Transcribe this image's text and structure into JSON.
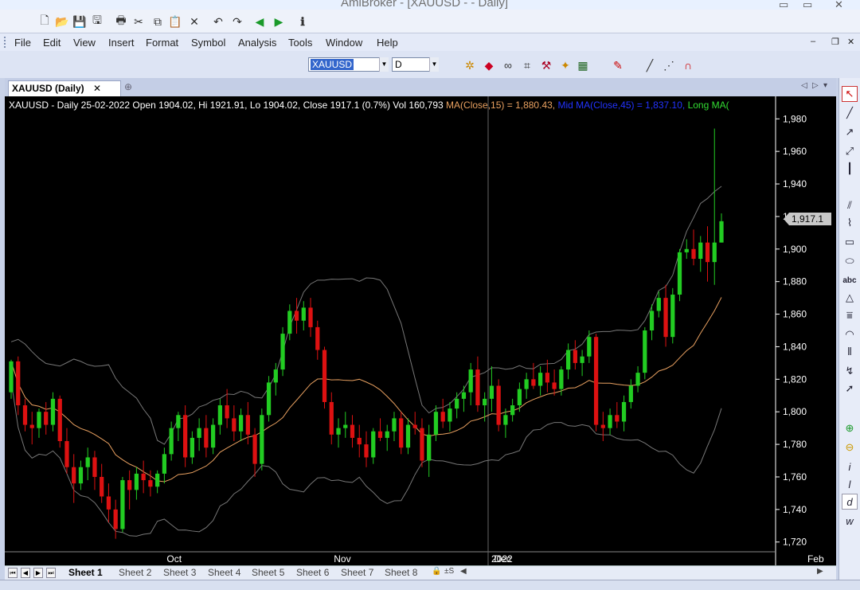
{
  "window": {
    "title": "AmiBroker - [XAUUSD -  - Daily]"
  },
  "menu": [
    "File",
    "Edit",
    "View",
    "Insert",
    "Format",
    "Symbol",
    "Analysis",
    "Tools",
    "Window",
    "Help"
  ],
  "toolbar2": {
    "symbol": "XAUUSD",
    "interval": "D"
  },
  "tab": {
    "label": "XAUUSD (Daily)"
  },
  "header": {
    "main": "XAUUSD - Daily 25-02-2022 Open 1904.02, Hi 1921.91, Lo 1904.02, Close 1917.1 (0.7%) Vol 160,793",
    "ma": "MA(Close,15) = 1,880.43,",
    "mid": "Mid MA(Close,45) = 1,837.10,",
    "long": "Long MA("
  },
  "colors": {
    "ma": "#e8a060",
    "mid": "#2233ff",
    "long": "#33dd33",
    "up": "#22cc22",
    "down": "#dd1111"
  },
  "price_badge": "1,917.1",
  "sheets": [
    "Sheet 1",
    "Sheet 2",
    "Sheet 3",
    "Sheet 4",
    "Sheet 5",
    "Sheet 6",
    "Sheet 7",
    "Sheet 8"
  ],
  "chart_data": {
    "type": "candlestick",
    "y_ticks": [
      1980,
      1960,
      1940,
      1920,
      1900,
      1880,
      1860,
      1840,
      1820,
      1800,
      1780,
      1760,
      1740,
      1720
    ],
    "ylim": [
      1714,
      1986
    ],
    "x_ticks": [
      "Oct",
      "Nov",
      "Dec",
      "2022",
      "Feb"
    ],
    "last_close": 1917.1,
    "candles": [
      [
        1812,
        1832,
        1808,
        1831
      ],
      [
        1831,
        1834,
        1798,
        1804
      ],
      [
        1804,
        1808,
        1788,
        1792
      ],
      [
        1792,
        1800,
        1780,
        1790
      ],
      [
        1790,
        1802,
        1784,
        1800
      ],
      [
        1800,
        1806,
        1786,
        1792
      ],
      [
        1792,
        1812,
        1788,
        1808
      ],
      [
        1808,
        1810,
        1778,
        1782
      ],
      [
        1782,
        1790,
        1762,
        1766
      ],
      [
        1766,
        1774,
        1744,
        1756
      ],
      [
        1756,
        1770,
        1752,
        1766
      ],
      [
        1766,
        1778,
        1758,
        1772
      ],
      [
        1772,
        1776,
        1752,
        1760
      ],
      [
        1760,
        1768,
        1744,
        1748
      ],
      [
        1748,
        1756,
        1732,
        1740
      ],
      [
        1740,
        1746,
        1722,
        1728
      ],
      [
        1728,
        1760,
        1726,
        1758
      ],
      [
        1758,
        1764,
        1740,
        1752
      ],
      [
        1752,
        1766,
        1746,
        1762
      ],
      [
        1762,
        1770,
        1750,
        1758
      ],
      [
        1758,
        1764,
        1748,
        1754
      ],
      [
        1754,
        1764,
        1750,
        1762
      ],
      [
        1762,
        1778,
        1756,
        1774
      ],
      [
        1774,
        1794,
        1770,
        1790
      ],
      [
        1790,
        1800,
        1782,
        1798
      ],
      [
        1798,
        1804,
        1766,
        1772
      ],
      [
        1772,
        1788,
        1768,
        1784
      ],
      [
        1784,
        1796,
        1776,
        1790
      ],
      [
        1790,
        1798,
        1772,
        1778
      ],
      [
        1778,
        1796,
        1774,
        1792
      ],
      [
        1792,
        1808,
        1786,
        1804
      ],
      [
        1804,
        1814,
        1790,
        1796
      ],
      [
        1796,
        1804,
        1782,
        1788
      ],
      [
        1788,
        1802,
        1782,
        1798
      ],
      [
        1798,
        1806,
        1780,
        1786
      ],
      [
        1786,
        1790,
        1760,
        1768
      ],
      [
        1768,
        1802,
        1764,
        1798
      ],
      [
        1798,
        1822,
        1794,
        1818
      ],
      [
        1818,
        1830,
        1810,
        1826
      ],
      [
        1826,
        1852,
        1822,
        1848
      ],
      [
        1848,
        1866,
        1844,
        1862
      ],
      [
        1862,
        1870,
        1848,
        1856
      ],
      [
        1856,
        1868,
        1850,
        1864
      ],
      [
        1864,
        1870,
        1846,
        1852
      ],
      [
        1852,
        1856,
        1832,
        1838
      ],
      [
        1838,
        1840,
        1802,
        1806
      ],
      [
        1806,
        1812,
        1780,
        1786
      ],
      [
        1786,
        1796,
        1778,
        1790
      ],
      [
        1790,
        1800,
        1784,
        1792
      ],
      [
        1792,
        1798,
        1778,
        1784
      ],
      [
        1784,
        1792,
        1772,
        1780
      ],
      [
        1780,
        1788,
        1766,
        1772
      ],
      [
        1772,
        1790,
        1768,
        1788
      ],
      [
        1788,
        1796,
        1782,
        1784
      ],
      [
        1784,
        1792,
        1776,
        1788
      ],
      [
        1788,
        1800,
        1782,
        1796
      ],
      [
        1796,
        1800,
        1774,
        1778
      ],
      [
        1778,
        1796,
        1774,
        1792
      ],
      [
        1792,
        1800,
        1786,
        1790
      ],
      [
        1790,
        1796,
        1766,
        1770
      ],
      [
        1770,
        1792,
        1760,
        1786
      ],
      [
        1786,
        1804,
        1782,
        1800
      ],
      [
        1800,
        1808,
        1790,
        1794
      ],
      [
        1794,
        1806,
        1788,
        1802
      ],
      [
        1802,
        1812,
        1796,
        1808
      ],
      [
        1808,
        1816,
        1800,
        1812
      ],
      [
        1812,
        1830,
        1804,
        1826
      ],
      [
        1826,
        1834,
        1800,
        1804
      ],
      [
        1804,
        1812,
        1794,
        1808
      ],
      [
        1808,
        1828,
        1800,
        1816
      ],
      [
        1816,
        1820,
        1788,
        1792
      ],
      [
        1792,
        1802,
        1784,
        1798
      ],
      [
        1798,
        1808,
        1794,
        1804
      ],
      [
        1804,
        1818,
        1800,
        1814
      ],
      [
        1814,
        1824,
        1808,
        1820
      ],
      [
        1820,
        1830,
        1814,
        1816
      ],
      [
        1816,
        1828,
        1810,
        1824
      ],
      [
        1824,
        1832,
        1812,
        1818
      ],
      [
        1818,
        1826,
        1810,
        1814
      ],
      [
        1814,
        1828,
        1810,
        1826
      ],
      [
        1826,
        1842,
        1820,
        1838
      ],
      [
        1838,
        1844,
        1826,
        1830
      ],
      [
        1830,
        1838,
        1822,
        1834
      ],
      [
        1834,
        1850,
        1830,
        1846
      ],
      [
        1846,
        1848,
        1788,
        1792
      ],
      [
        1792,
        1800,
        1782,
        1790
      ],
      [
        1790,
        1802,
        1786,
        1798
      ],
      [
        1798,
        1806,
        1790,
        1794
      ],
      [
        1794,
        1810,
        1788,
        1806
      ],
      [
        1806,
        1820,
        1802,
        1816
      ],
      [
        1816,
        1828,
        1812,
        1824
      ],
      [
        1824,
        1852,
        1820,
        1850
      ],
      [
        1850,
        1866,
        1844,
        1862
      ],
      [
        1862,
        1874,
        1858,
        1870
      ],
      [
        1870,
        1878,
        1840,
        1846
      ],
      [
        1846,
        1876,
        1842,
        1872
      ],
      [
        1872,
        1900,
        1868,
        1898
      ],
      [
        1898,
        1906,
        1894,
        1900
      ],
      [
        1900,
        1912,
        1890,
        1894
      ],
      [
        1894,
        1908,
        1886,
        1904
      ],
      [
        1904,
        1914,
        1880,
        1892
      ],
      [
        1892,
        1974,
        1878,
        1904
      ],
      [
        1904,
        1921.91,
        1904,
        1917.1
      ]
    ],
    "series": [
      {
        "name": "MA(Close,15)",
        "color": "#e8a060"
      },
      {
        "name": "Mid MA(Close,45)",
        "color": "#2233ff"
      },
      {
        "name": "Long MA(",
        "color": "#33dd33"
      }
    ]
  }
}
